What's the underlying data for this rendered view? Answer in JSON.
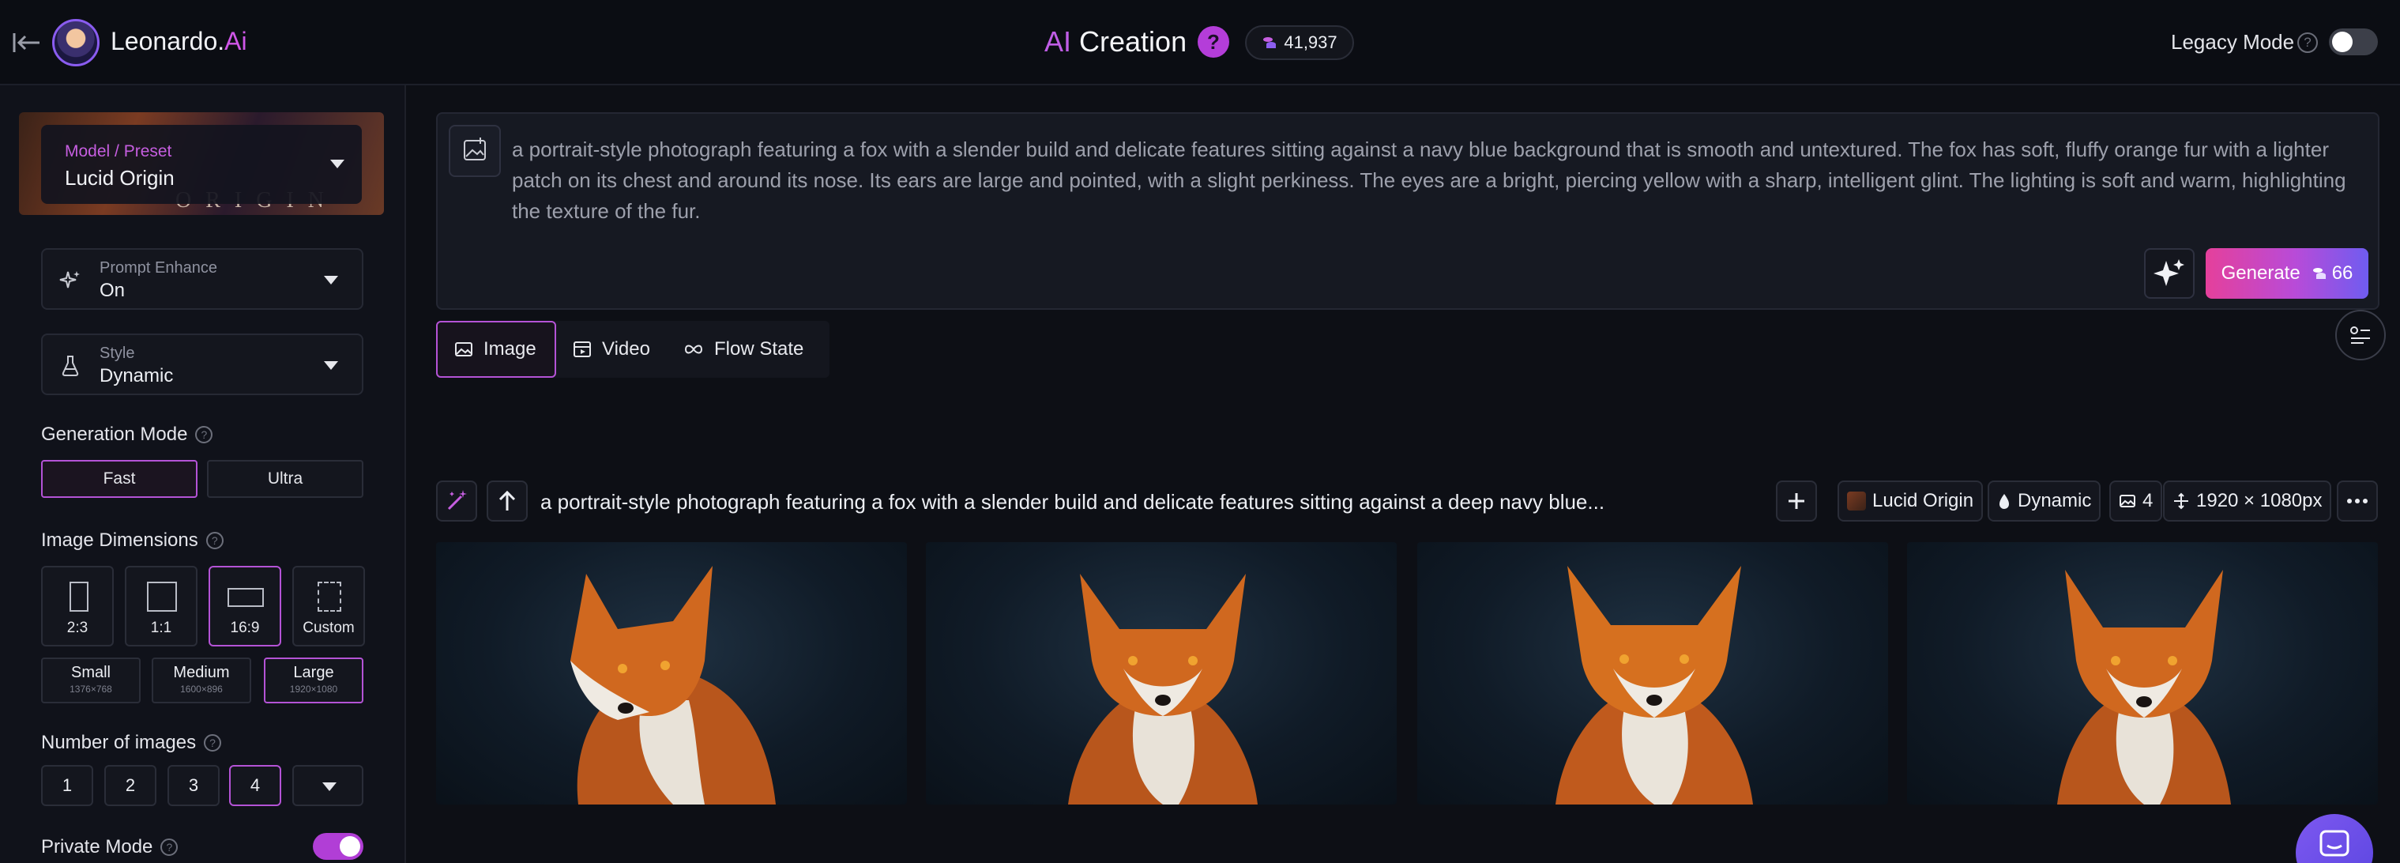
{
  "header": {
    "brand_name": "Leonardo.",
    "brand_suffix": "Ai",
    "page_title_prefix": "AI",
    "page_title": " Creation",
    "help_badge": "?",
    "token_count": "41,937",
    "legacy_mode_label": "Legacy Mode",
    "legacy_mode_on": false
  },
  "sidebar": {
    "model": {
      "label": "Model / Preset",
      "value": "Lucid Origin",
      "banner_text": "ORIGIN"
    },
    "prompt_enhance": {
      "label": "Prompt Enhance",
      "value": "On"
    },
    "style": {
      "label": "Style",
      "value": "Dynamic"
    },
    "generation_mode": {
      "label": "Generation Mode",
      "options": [
        "Fast",
        "Ultra"
      ],
      "selected": "Fast"
    },
    "image_dimensions": {
      "label": "Image Dimensions",
      "ratios": [
        "2:3",
        "1:1",
        "16:9",
        "Custom"
      ],
      "selected_ratio": "16:9",
      "sizes": [
        {
          "name": "Small",
          "px": "1376×768"
        },
        {
          "name": "Medium",
          "px": "1600×896"
        },
        {
          "name": "Large",
          "px": "1920×1080"
        }
      ],
      "selected_size": "Large"
    },
    "number_of_images": {
      "label": "Number of images",
      "options": [
        "1",
        "2",
        "3",
        "4"
      ],
      "selected": "4"
    },
    "private_mode": {
      "label": "Private Mode",
      "on": true
    }
  },
  "prompt": {
    "text": "a portrait-style photograph featuring a fox with a slender build and delicate features sitting against a navy blue background that is smooth and untextured. The fox has soft, fluffy orange fur with a lighter patch on its chest and around its nose. Its ears are large and pointed, with a slight perkiness. The eyes are a bright, piercing yellow with a sharp, intelligent glint. The lighting is soft and warm, highlighting the texture of the fur.",
    "generate_label": "Generate",
    "generate_cost": "66"
  },
  "mode_tabs": [
    {
      "label": "Image",
      "icon": "image-icon",
      "active": true
    },
    {
      "label": "Video",
      "icon": "video-icon",
      "active": false
    },
    {
      "label": "Flow State",
      "icon": "infinity-icon",
      "active": false
    }
  ],
  "generation": {
    "prompt_preview": "a portrait-style photograph featuring a fox with a slender build and delicate features sitting against a deep navy blue...",
    "model_chip": "Lucid Origin",
    "style_chip": "Dynamic",
    "count_chip": "4",
    "size_chip": "1920 × 1080px",
    "images": [
      "fox-portrait-1",
      "fox-portrait-2",
      "fox-portrait-3",
      "fox-portrait-4"
    ]
  },
  "colors": {
    "accent": "#b453d6",
    "background": "#0d0f15",
    "panel": "#10121a",
    "generate_gradient_start": "#e5409b",
    "generate_gradient_end": "#6f5cf0"
  }
}
